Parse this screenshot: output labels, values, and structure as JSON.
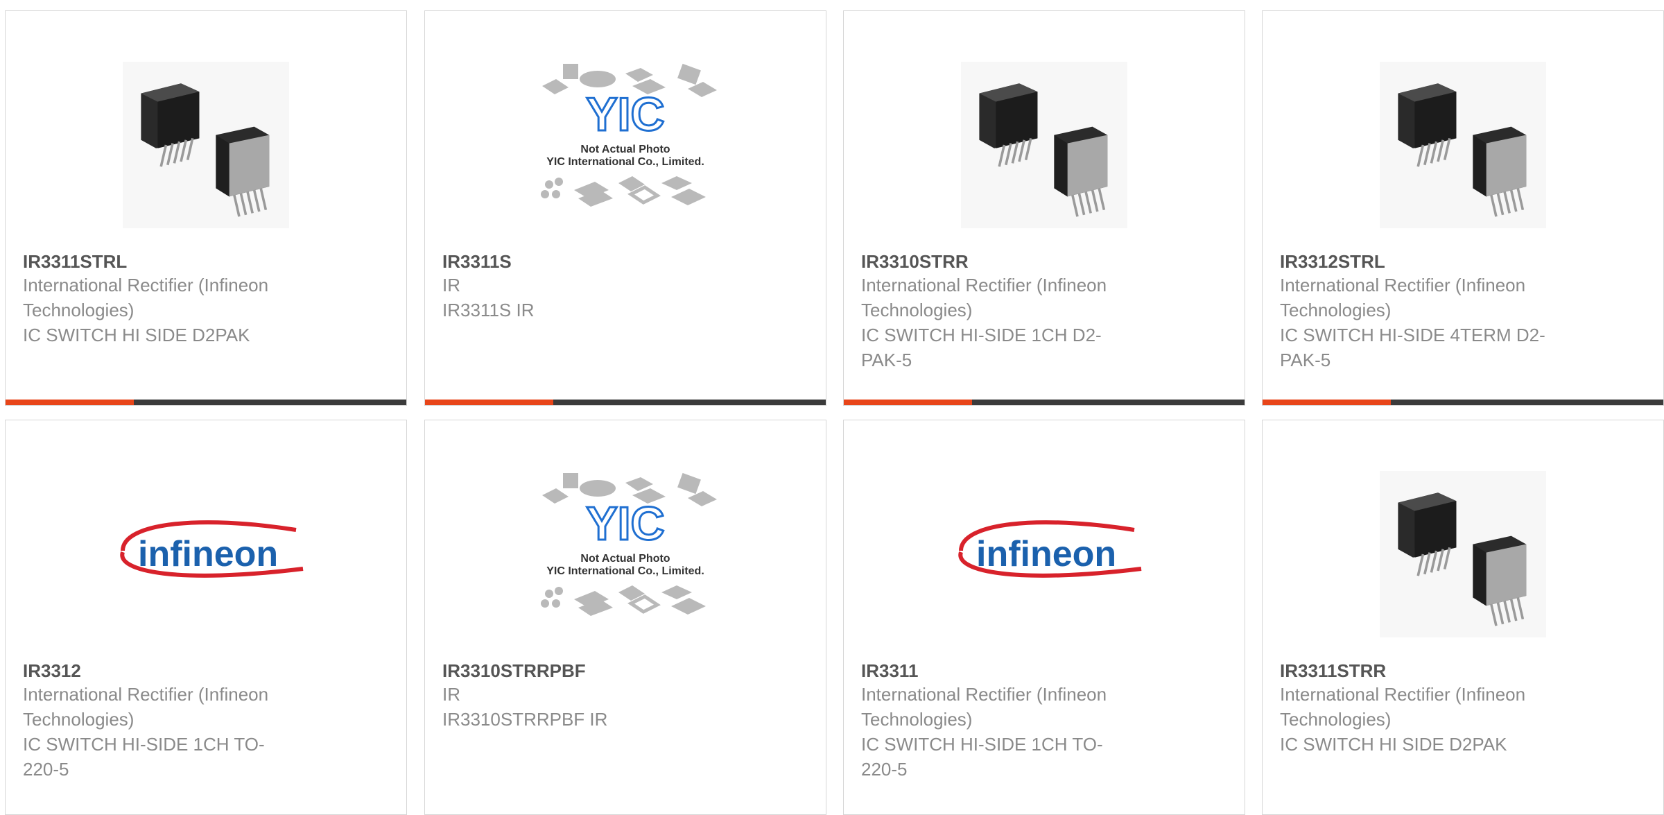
{
  "colors": {
    "accent": "#e84519",
    "bar": "#3b3b3b",
    "infineon_red": "#d8222b",
    "infineon_blue": "#1b61ad",
    "yic_blue": "#1f6fd1"
  },
  "products": [
    {
      "part": "IR3311STRL",
      "manufacturer": "International Rectifier (Infineon Technologies)",
      "description": "IC SWITCH HI SIDE D2PAK",
      "image": "d2pak-package-photo",
      "progress_bar": true
    },
    {
      "part": "IR3311S",
      "manufacturer": "IR",
      "description": "IR3311S IR",
      "image": "yic-placeholder",
      "progress_bar": true
    },
    {
      "part": "IR3310STRR",
      "manufacturer": "International Rectifier (Infineon Technologies)",
      "description": "IC SWITCH HI-SIDE 1CH D2-PAK-5",
      "image": "d2pak-package-photo",
      "progress_bar": true
    },
    {
      "part": "IR3312STRL",
      "manufacturer": "International Rectifier (Infineon Technologies)",
      "description": "IC SWITCH HI-SIDE 4TERM D2-PAK-5",
      "image": "d2pak-package-photo",
      "progress_bar": true
    },
    {
      "part": "IR3312",
      "manufacturer": "International Rectifier (Infineon Technologies)",
      "description": "IC SWITCH HI-SIDE 1CH TO-220-5",
      "image": "infineon-logo",
      "progress_bar": false
    },
    {
      "part": "IR3310STRRPBF",
      "manufacturer": "IR",
      "description": "IR3310STRRPBF IR",
      "image": "yic-placeholder",
      "progress_bar": false
    },
    {
      "part": "IR3311",
      "manufacturer": "International Rectifier (Infineon Technologies)",
      "description": "IC SWITCH HI-SIDE 1CH TO-220-5",
      "image": "infineon-logo",
      "progress_bar": false
    },
    {
      "part": "IR3311STRR",
      "manufacturer": "International Rectifier (Infineon Technologies)",
      "description": "IC SWITCH HI SIDE D2PAK",
      "image": "d2pak-package-photo",
      "progress_bar": false
    }
  ],
  "logo_text": {
    "infineon": "infineon",
    "yic": "YIC",
    "yic_note_1": "Not Actual Photo",
    "yic_note_2": "YIC International Co., Limited."
  }
}
